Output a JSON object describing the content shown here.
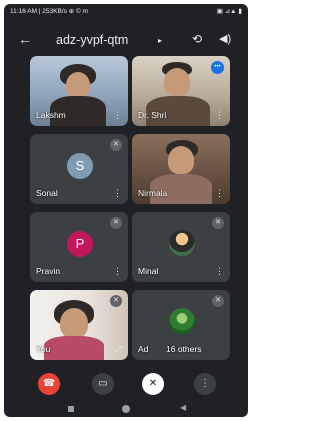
{
  "statusbar": {
    "left": "11:16 AM | 253KB/s ⊕ © m",
    "right": "▣ ⊿▲ ▮"
  },
  "meeting": {
    "code": "adz-yvpf-qtm"
  },
  "icons": {
    "back": "←",
    "caret": "▸",
    "flip": "⟲",
    "volume": "◀)",
    "more_vert": "⋮",
    "mic_off": "✕",
    "speaking": "•••",
    "hangup": "☎",
    "camera": "▭",
    "mic": "✕",
    "nav_back": "◀",
    "expand": "⤢"
  },
  "participants": [
    {
      "name": "Lakshm",
      "type": "video"
    },
    {
      "name": "Dr. Shri",
      "type": "video"
    },
    {
      "name": "Sonal",
      "type": "avatar",
      "initial": "S"
    },
    {
      "name": "Nirmala",
      "type": "video"
    },
    {
      "name": "Pravin",
      "type": "avatar",
      "initial": "P"
    },
    {
      "name": "Minal",
      "type": "photo-avatar"
    },
    {
      "name": "You",
      "type": "self-video"
    },
    {
      "name": "Ad",
      "type": "photo-avatar",
      "others_label": "16 others"
    }
  ],
  "colors": {
    "background": "#202124",
    "hangup": "#ea4335",
    "speaking": "#1a73e8"
  }
}
